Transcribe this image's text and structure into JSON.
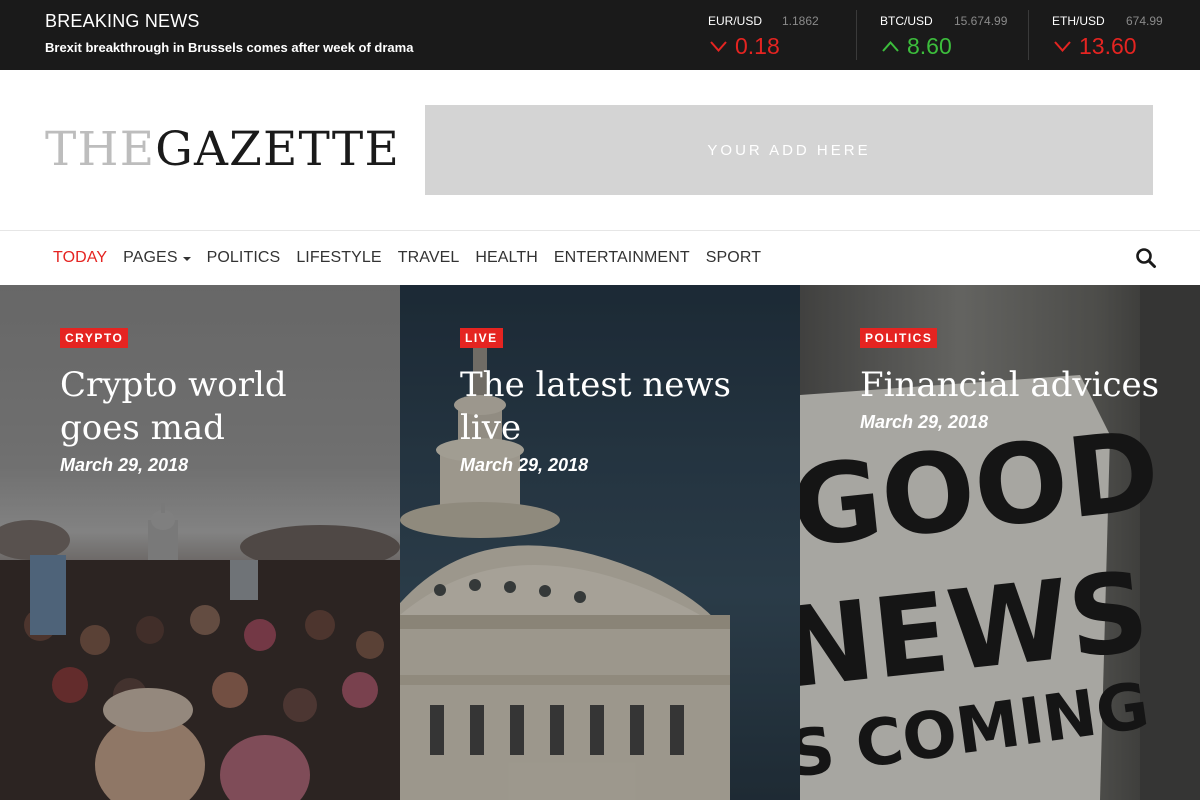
{
  "topbar": {
    "breaking_title": "BREAKING NEWS",
    "breaking_headline": "Brexit breakthrough in Brussels comes after week of drama",
    "tickers": [
      {
        "pair": "EUR/USD",
        "price": "1.1862",
        "change": "0.18",
        "direction": "down"
      },
      {
        "pair": "BTC/USD",
        "price": "15.674.99",
        "change": "8.60",
        "direction": "up"
      },
      {
        "pair": "ETH/USD",
        "price": "674.99",
        "change": "13.60",
        "direction": "down"
      }
    ]
  },
  "header": {
    "logo_light": "THE",
    "logo_dark": "GAZETTE",
    "ad_text": "YOUR ADD HERE"
  },
  "nav": {
    "items": [
      {
        "label": "TODAY",
        "active": true
      },
      {
        "label": "PAGES",
        "dropdown": true
      },
      {
        "label": "POLITICS"
      },
      {
        "label": "LIFESTYLE"
      },
      {
        "label": "TRAVEL"
      },
      {
        "label": "HEALTH"
      },
      {
        "label": "ENTERTAINMENT"
      },
      {
        "label": "SPORT"
      }
    ],
    "search_icon": "search-icon"
  },
  "cards": [
    {
      "category": "CRYPTO",
      "title": "Crypto world goes mad",
      "date": "March 29, 2018"
    },
    {
      "category": "LIVE",
      "title": "The latest news live",
      "date": "March 29, 2018"
    },
    {
      "category": "POLITICS",
      "title": "Financial advices",
      "date": "March 29, 2018",
      "poster_text": [
        "GOOD",
        "NEWS",
        "S COMING"
      ]
    }
  ],
  "colors": {
    "accent": "#e52421",
    "up": "#3cbd3c",
    "topbar_bg": "#1a1a1a",
    "ad_bg": "#d4d4d4"
  }
}
